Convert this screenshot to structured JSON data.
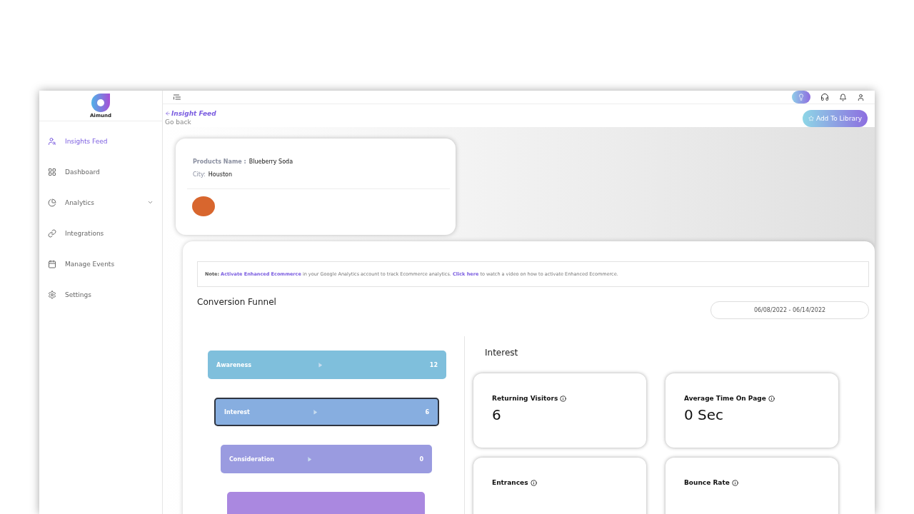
{
  "brand": {
    "name": "Aimund"
  },
  "sidebar": {
    "items": [
      {
        "label": "Insights Feed",
        "kind": "insights",
        "selected": true,
        "expandable": false
      },
      {
        "label": "Dashboard",
        "kind": "grid",
        "selected": false,
        "expandable": false
      },
      {
        "label": "Analytics",
        "kind": "pie",
        "selected": false,
        "expandable": true
      },
      {
        "label": "Integrations",
        "kind": "link",
        "selected": false,
        "expandable": false
      },
      {
        "label": "Manage Events",
        "kind": "calendar",
        "selected": false,
        "expandable": false
      },
      {
        "label": "Settings",
        "kind": "gear",
        "selected": false,
        "expandable": false
      }
    ]
  },
  "breadcrumb": {
    "title": "Insight Feed",
    "back": "Go back"
  },
  "add_button": "Add To Library",
  "product": {
    "name_label": "Products Name :",
    "name": "Blueberry Soda",
    "city_label": "City:",
    "city": "Houston"
  },
  "note_parts": [
    {
      "kind": "bold",
      "text": "Note:"
    },
    {
      "kind": "link",
      "text": "Activate Enhanced Ecommerce"
    },
    {
      "kind": "plain",
      "text": "in your Google Analytics account to track Ecommerce analytics."
    },
    {
      "kind": "link",
      "text": "Click here"
    },
    {
      "kind": "plain",
      "text": "to watch a video on how to activate Enhanced Ecommerce."
    }
  ],
  "funnel": {
    "title": "Conversion Funnel",
    "date_range": "06/08/2022 - 06/14/2022",
    "stages": [
      {
        "label": "Awareness",
        "count": "12",
        "color": "#7fbfdc",
        "selected": false
      },
      {
        "label": "Interest",
        "count": "6",
        "color": "#87aee0",
        "selected": true
      },
      {
        "label": "Consideration",
        "count": "0",
        "color": "#9a9be0",
        "selected": false
      },
      {
        "color": "#aa88e0",
        "selected": false
      }
    ]
  },
  "detail": {
    "title": "Interest",
    "metrics": [
      {
        "label": "Returning Visitors",
        "value": "6"
      },
      {
        "label": "Average Time On Page",
        "value": "0 Sec"
      },
      {
        "label": "Entrances"
      },
      {
        "label": "Bounce Rate"
      }
    ]
  }
}
